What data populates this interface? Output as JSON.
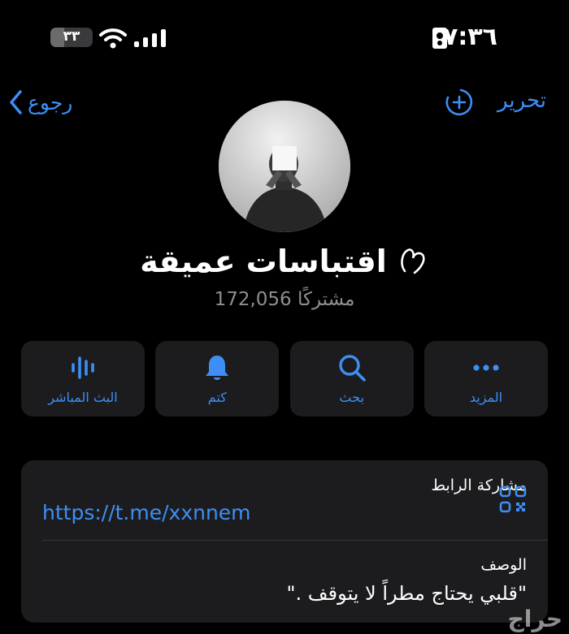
{
  "status_bar": {
    "time": "٧:٣٦",
    "battery_level": "٣٣",
    "battery_percent": 33,
    "contact_icon": "person-card-icon",
    "wifi_icon": "wifi-icon",
    "signal_icon": "cellular-signal-icon"
  },
  "nav": {
    "back_label": "رجوع",
    "edit_label": "تحرير",
    "add_icon": "add-circle-icon"
  },
  "channel": {
    "title": "اقتباسات عميقة",
    "title_emoji": "hand-heart-icon",
    "subscribers": "172,056 مشتركًا"
  },
  "actions": [
    {
      "label": "البث المباشر",
      "icon": "live-waveform-icon"
    },
    {
      "label": "كتم",
      "icon": "bell-icon"
    },
    {
      "label": "بحث",
      "icon": "search-icon"
    },
    {
      "label": "المزيد",
      "icon": "more-icon"
    }
  ],
  "info": {
    "link_label": "مشاركة الرابط",
    "link_value": "https://t.me/xxnnem",
    "qr_icon": "qr-code-icon",
    "description_label": "الوصف",
    "description_value": "\"قلبي يحتاج مطراً لا يتوقف .\""
  },
  "watermark": "حراج",
  "colors": {
    "accent": "#3d8ff5",
    "background": "#000000",
    "card": "#1c1c1e",
    "secondary_text": "#8e8e93"
  }
}
